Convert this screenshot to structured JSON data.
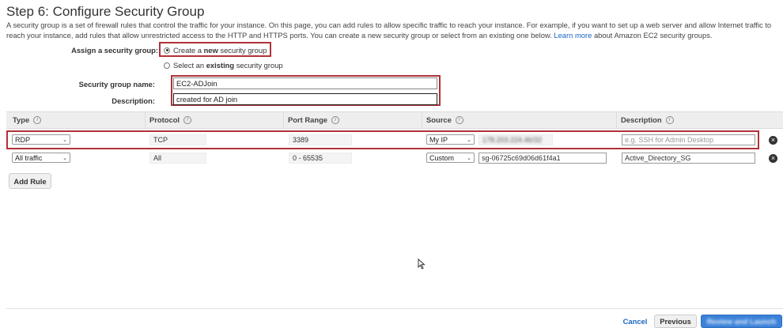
{
  "page": {
    "title": "Step 6: Configure Security Group",
    "intro": "A security group is a set of firewall rules that control the traffic for your instance. On this page, you can add rules to allow specific traffic to reach your instance. For example, if you want to set up a web server and allow Internet traffic to reach your instance, add rules that allow unrestricted access to the HTTP and HTTPS ports. You can create a new security group or select from an existing one below.",
    "learn_more": "Learn more",
    "intro_tail": "about Amazon EC2 security groups."
  },
  "assign": {
    "label": "Assign a security group:",
    "option_new_pre": "Create a ",
    "option_new_bold": "new",
    "option_new_post": " security group",
    "option_existing_pre": "Select an ",
    "option_existing_bold": "existing",
    "option_existing_post": " security group",
    "selected": "new"
  },
  "group": {
    "name_label": "Security group name:",
    "name_value": "EC2-ADJoin",
    "desc_label": "Description:",
    "desc_value": "created for AD join"
  },
  "table": {
    "headers": [
      "Type",
      "Protocol",
      "Port Range",
      "Source",
      "Description"
    ],
    "rows": [
      {
        "type": "RDP",
        "protocol": "TCP",
        "port_range": "3389",
        "source_type": "My IP",
        "source_value": "178.203.224.46/32",
        "description": "",
        "description_placeholder": "e.g. SSH for Admin Desktop"
      },
      {
        "type": "All traffic",
        "protocol": "All",
        "port_range": "0 - 65535",
        "source_type": "Custom",
        "source_value": "sg-06725c69d06d61f4a1",
        "description": "Active_Directory_SG",
        "description_placeholder": ""
      }
    ]
  },
  "buttons": {
    "add_rule": "Add Rule",
    "cancel": "Cancel",
    "previous": "Previous",
    "review_launch": "Review and Launch"
  },
  "colors": {
    "highlight": "#b0323a",
    "link": "#1a66c2",
    "primary": "#3b82d9"
  }
}
